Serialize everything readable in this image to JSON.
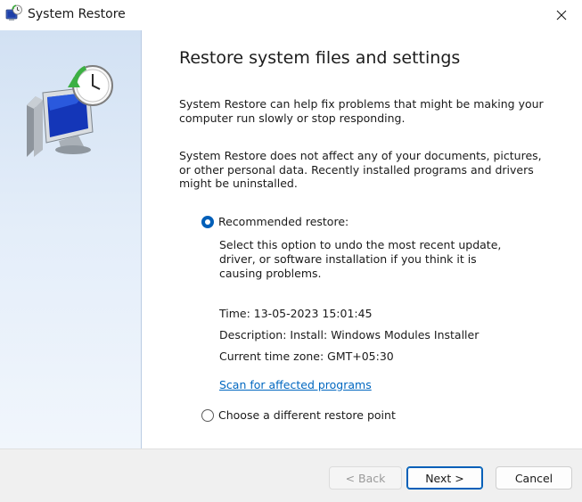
{
  "window": {
    "title": "System Restore",
    "app_icon": "system-restore-icon",
    "close_icon": "close-icon"
  },
  "main": {
    "heading": "Restore system files and settings",
    "paragraph1": "System Restore can help fix problems that might be making your computer run slowly or stop responding.",
    "paragraph2": "System Restore does not affect any of your documents, pictures, or other personal data. Recently installed programs and drivers might be uninstalled.",
    "recommended": {
      "label": "Recommended restore:",
      "checked": true,
      "description": "Select this option to undo the most recent update, driver, or software installation if you think it is causing problems.",
      "time": "Time: 13-05-2023 15:01:45",
      "desc": "Description: Install: Windows Modules Installer",
      "timezone": "Current time zone: GMT+05:30",
      "scan_link": "Scan for affected programs"
    },
    "different": {
      "label": "Choose a different restore point",
      "checked": false
    }
  },
  "footer": {
    "back": "< Back",
    "next": "Next >",
    "cancel": "Cancel"
  },
  "colors": {
    "accent": "#005fb8",
    "link": "#0067c0",
    "panel_top": "#d2e1f3",
    "footer_bg": "#f0f0f0"
  }
}
